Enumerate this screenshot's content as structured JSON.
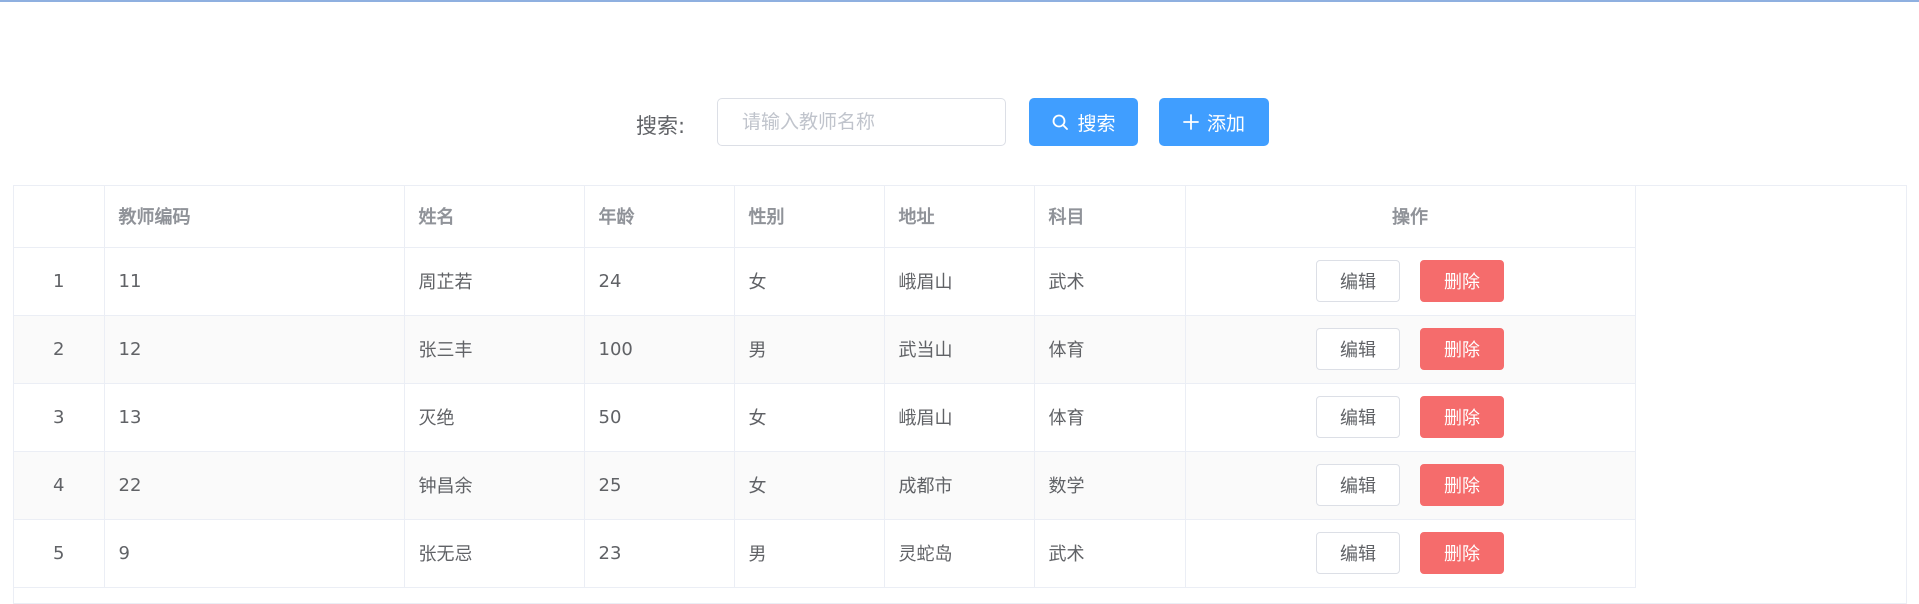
{
  "search": {
    "label": "搜索:",
    "placeholder": "请输入教师名称",
    "value": "",
    "search_button_label": "搜索",
    "add_button_label": "添加"
  },
  "table": {
    "columns": [
      "",
      "教师编码",
      "姓名",
      "年龄",
      "性别",
      "地址",
      "科目",
      "操作"
    ],
    "rows": [
      {
        "index": "1",
        "code": "11",
        "name": "周芷若",
        "age": "24",
        "gender": "女",
        "address": "峨眉山",
        "subject": "武术"
      },
      {
        "index": "2",
        "code": "12",
        "name": "张三丰",
        "age": "100",
        "gender": "男",
        "address": "武当山",
        "subject": "体育"
      },
      {
        "index": "3",
        "code": "13",
        "name": "灭绝",
        "age": "50",
        "gender": "女",
        "address": "峨眉山",
        "subject": "体育"
      },
      {
        "index": "4",
        "code": "22",
        "name": "钟昌余",
        "age": "25",
        "gender": "女",
        "address": "成都市",
        "subject": "数学"
      },
      {
        "index": "5",
        "code": "9",
        "name": "张无忌",
        "age": "23",
        "gender": "男",
        "address": "灵蛇岛",
        "subject": "武术"
      }
    ],
    "edit_label": "编辑",
    "delete_label": "删除"
  },
  "colors": {
    "primary": "#409eff",
    "danger": "#f56c6c",
    "border": "#ebeef5",
    "stripe": "#fafafa"
  },
  "icons": {
    "search_button_icon": "search-icon",
    "add_button_icon": "plus-icon"
  }
}
